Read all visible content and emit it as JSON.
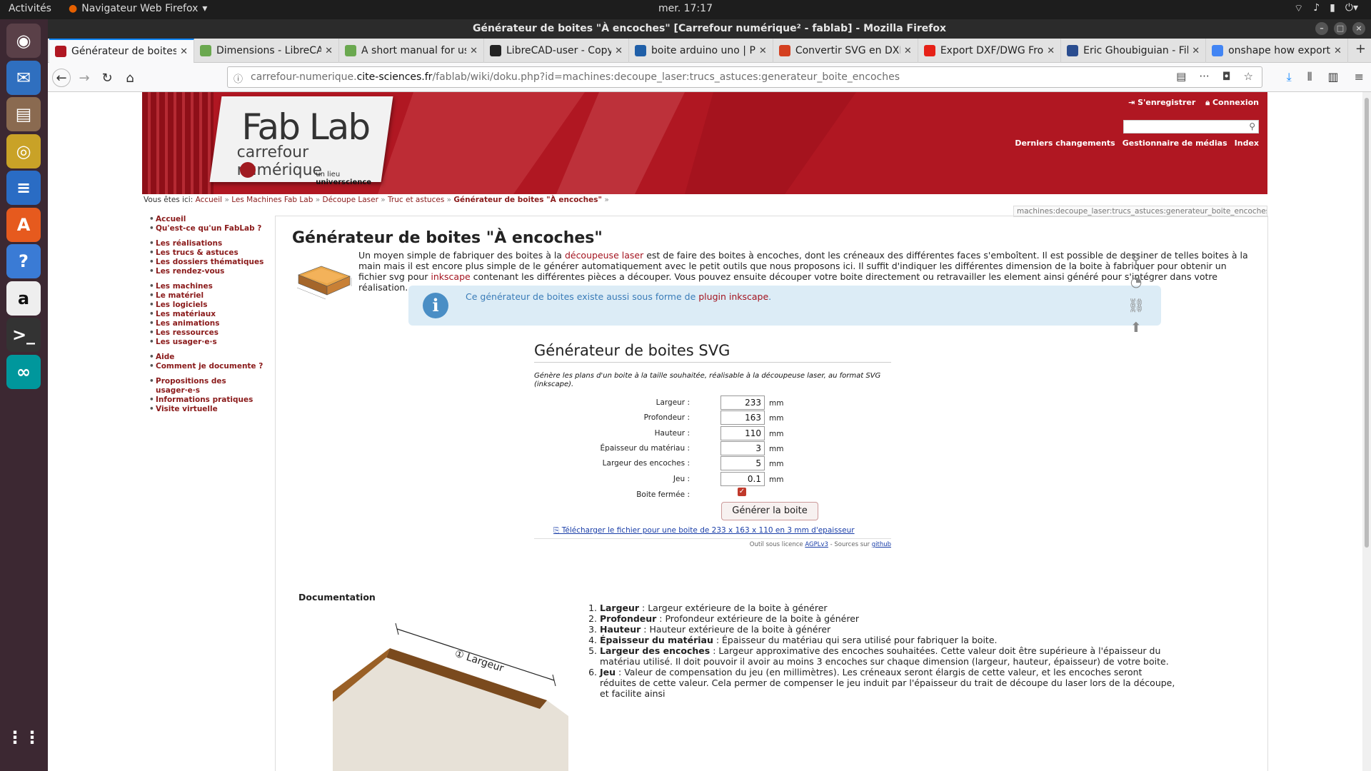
{
  "topbar": {
    "activities": "Activités",
    "app_menu": "Navigateur Web Firefox",
    "clock": "mer. 17:17"
  },
  "dock": [
    {
      "name": "firefox-icon",
      "color": "#e66000",
      "glyph": "◉"
    },
    {
      "name": "thunderbird-icon",
      "color": "#2f6fbf",
      "glyph": "✉"
    },
    {
      "name": "files-icon",
      "color": "#8a6a50",
      "glyph": "▤"
    },
    {
      "name": "rhythmbox-icon",
      "color": "#c9a227",
      "glyph": "◎"
    },
    {
      "name": "libreoffice-writer-icon",
      "color": "#2a6cc4",
      "glyph": "≡"
    },
    {
      "name": "ubuntu-software-icon",
      "color": "#e65a1e",
      "glyph": "A"
    },
    {
      "name": "help-icon",
      "color": "#3a7bd5",
      "glyph": "?"
    },
    {
      "name": "amazon-icon",
      "color": "#eeeeee",
      "glyph": "a"
    },
    {
      "name": "terminal-icon",
      "color": "#333333",
      "glyph": ">_"
    },
    {
      "name": "arduino-icon",
      "color": "#00979c",
      "glyph": "∞"
    }
  ],
  "window": {
    "title": "Générateur de boites \"À encoches\" [Carrefour numérique² - fablab] - Mozilla Firefox"
  },
  "tabs": [
    {
      "label": "Générateur de boites",
      "color": "#b01722",
      "active": true
    },
    {
      "label": "Dimensions - LibreCA",
      "color": "#6aa84f"
    },
    {
      "label": "A short manual for us",
      "color": "#6aa84f"
    },
    {
      "label": "LibreCAD-user - Copy",
      "color": "#222222"
    },
    {
      "label": "boite arduino uno | P",
      "color": "#1f5fa8"
    },
    {
      "label": "Convertir SVG en DXF",
      "color": "#d44020"
    },
    {
      "label": "Export DXF/DWG Fro",
      "color": "#e62117"
    },
    {
      "label": "Eric Ghoubiguian - File",
      "color": "#2a4d8f"
    },
    {
      "label": "onshape how export",
      "color": "#4285f4"
    }
  ],
  "url": {
    "pre": "carrefour-numerique.",
    "host": "cite-sciences.fr",
    "path": "/fablab/wiki/doku.php?id=machines:decoupe_laser:trucs_astuces:generateur_boite_encoches"
  },
  "header": {
    "register": "S'enregistrer",
    "login": "Connexion",
    "recent": "Derniers changements",
    "media": "Gestionnaire de médias",
    "index": "Index",
    "logo_title": "Fab Lab",
    "logo_sub": "carrefour numérique",
    "logo_tag_pre": "un lieu ",
    "logo_tag_bold": "universcience"
  },
  "breadcrumb": {
    "prefix": "Vous êtes ici:",
    "items": [
      "Accueil",
      "Les Machines Fab Lab",
      "Découpe Laser",
      "Truc et astuces"
    ],
    "current": "Générateur de boites \"À encoches\"",
    "sep": "»"
  },
  "pageid": "machines:decoupe_laser:trucs_astuces:generateur_boite_encoches",
  "sidebar": [
    [
      "Accueil",
      "Qu'est-ce qu'un FabLab ?"
    ],
    [
      "Les réalisations",
      "Les trucs & astuces",
      "Les dossiers thématiques",
      "Les rendez-vous"
    ],
    [
      "Les machines",
      "Le matériel",
      "Les logiciels",
      "Les matériaux",
      "Les animations",
      "Les ressources",
      "Les usager·e·s"
    ],
    [
      "Aide",
      "Comment je documente ?"
    ],
    [
      "Propositions des usager·e·s",
      "Informations pratiques",
      "Visite virtuelle"
    ]
  ],
  "page": {
    "title": "Générateur de boites \"À encoches\"",
    "intro_1": "Un moyen simple de fabriquer des boites à la ",
    "intro_link1": "découpeuse laser",
    "intro_2": " est de faire des boites à encoches, dont les créneaux des différentes faces s'emboîtent. Il est possible de dessiner de telles boites à la main mais il est encore plus simple de le générer automatiquement avec le petit outils que nous proposons ici. Il suffit d'indiquer les différentes dimension de la boite à fabriquer pour obtenir un fichier svg pour ",
    "intro_link2": "inkscape",
    "intro_3": " contenant les différentes pièces a découper. Vous pouvez ensuite découper votre boite directement ou retravailler les element ainsi généré pour s'intégrer dans votre réalisation.",
    "info_text": "Ce générateur de boites existe aussi sous forme de ",
    "info_link": "plugin inkscape",
    "info_end": "."
  },
  "generator": {
    "title": "Générateur de boites SVG",
    "desc": "Génère les plans d'un boite à la taille souhaitée, réalisable à la découpeuse laser, au format SVG (inkscape).",
    "fields": [
      {
        "label": "Largeur :",
        "value": "233",
        "unit": "mm"
      },
      {
        "label": "Profondeur :",
        "value": "163",
        "unit": "mm"
      },
      {
        "label": "Hauteur :",
        "value": "110",
        "unit": "mm"
      },
      {
        "label": "Épaisseur du matériau :",
        "value": "3",
        "unit": "mm"
      },
      {
        "label": "Largeur des encoches :",
        "value": "5",
        "unit": "mm"
      },
      {
        "label": "Jeu :",
        "value": "0.1",
        "unit": "mm"
      }
    ],
    "closed_label": "Boite fermée :",
    "closed": true,
    "button": "Générer la boite",
    "download": "⎘ Télécharger le fichier pour une boite de 233 x 163 x 110 en 3 mm d'epaisseur",
    "lic_pre": "Outil sous licence ",
    "lic_link1": "AGPLv3",
    "lic_mid": " - Sources sur ",
    "lic_link2": "github"
  },
  "doc": {
    "heading": "Documentation",
    "diagram_label": "① Largeur",
    "items": [
      {
        "term": "Largeur",
        "text": " : Largeur extérieure de la boite à générer"
      },
      {
        "term": "Profondeur",
        "text": " : Profondeur extérieure de la boite à générer"
      },
      {
        "term": "Hauteur",
        "text": " : Hauteur extérieure de la boite à générer"
      },
      {
        "term": "Épaisseur du matériau",
        "text": " : Épaisseur du matériau qui sera utilisé pour fabriquer la boite."
      },
      {
        "term": "Largeur des encoches",
        "text": " : Largeur approximative des encoches souhaitées. Cette valeur doit être supérieure à l'épaisseur du matériau utilisé. Il doit pouvoir il avoir au moins 3 encoches sur chaque dimension (largeur, hauteur, épaisseur) de votre boite."
      },
      {
        "term": "Jeu",
        "text": " : Valeur de compensation du jeu (en millimètres). Les créneaux seront élargis de cette valeur, et les encoches seront réduites de cette valeur. Cela permer de compenser le jeu induit par l'épaisseur du trait de découpe du laser lors de la découpe, et facilite ainsi"
      }
    ]
  }
}
